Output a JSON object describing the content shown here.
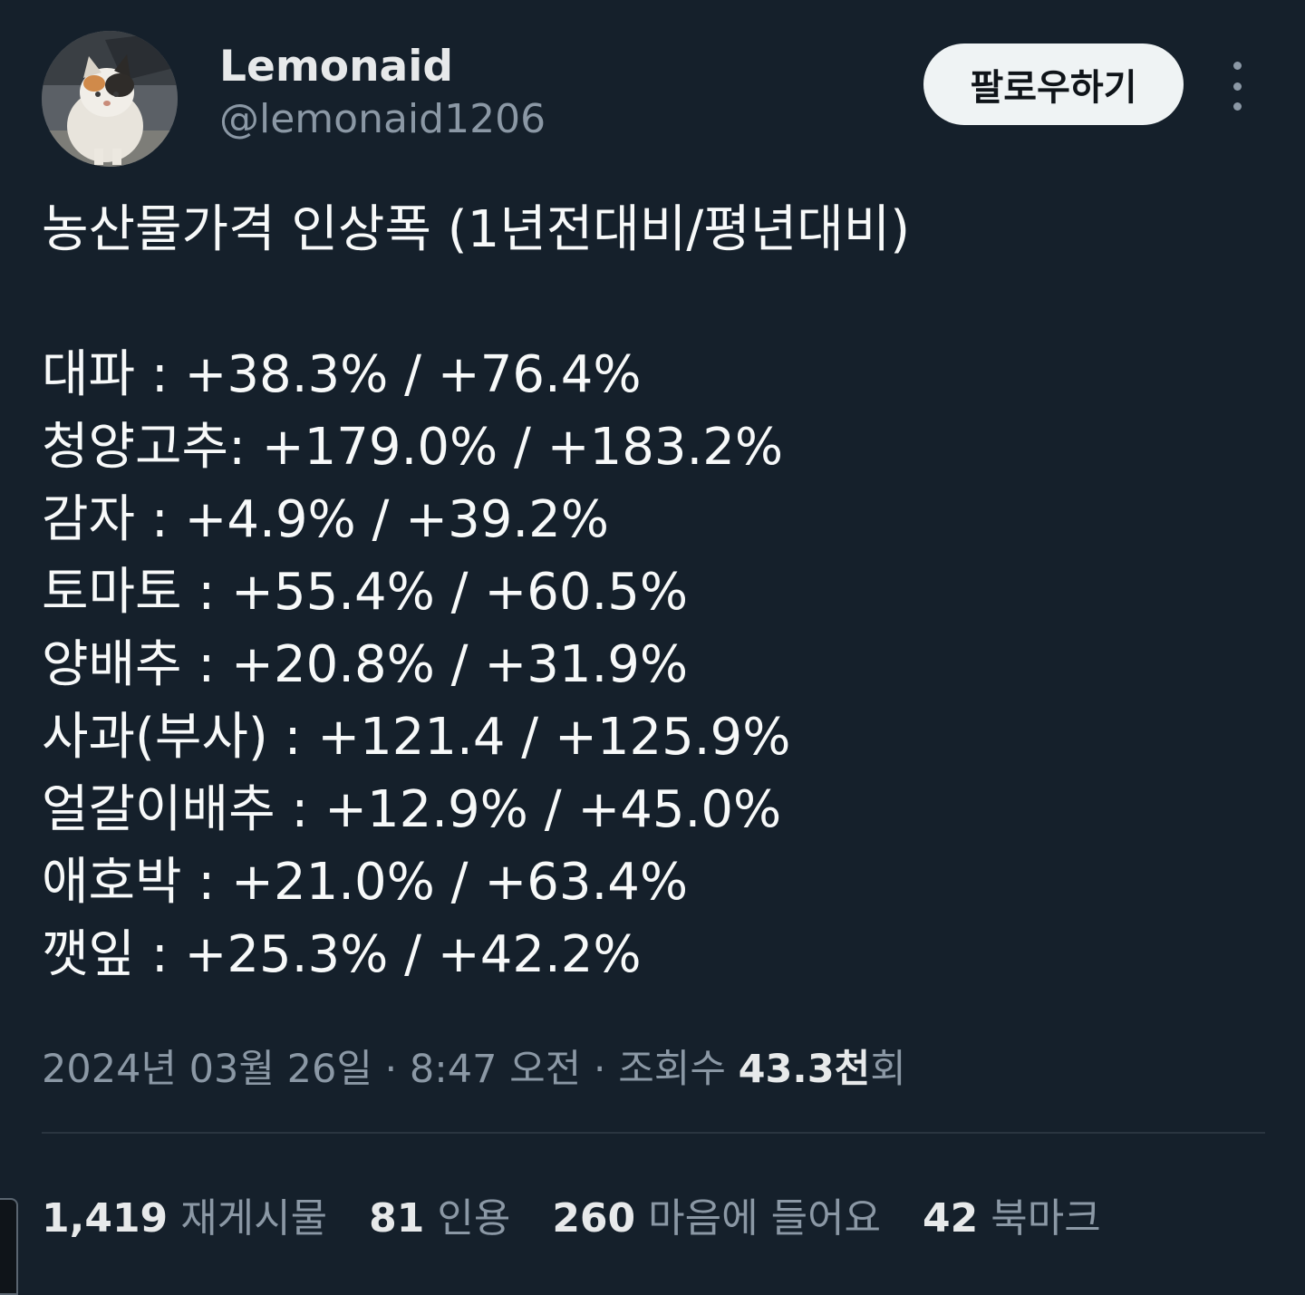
{
  "author": {
    "display_name": "Lemonaid",
    "handle": "@lemonaid1206"
  },
  "follow_label": "팔로우하기",
  "tweet": {
    "title": "농산물가격 인상폭 (1년전대비/평년대비)",
    "lines": [
      "대파 : +38.3% / +76.4%",
      "청양고추: +179.0% / +183.2%",
      "감자 : +4.9% / +39.2%",
      "토마토 : +55.4% / +60.5%",
      "양배추 : +20.8% / +31.9%",
      "사과(부사) : +121.4 / +125.9%",
      "얼갈이배추 : +12.9% / +45.0%",
      "애호박 : +21.0% / +63.4%",
      "깻잎 : +25.3% / +42.2%"
    ]
  },
  "meta": {
    "timestamp": "2024년 03월 26일 · 8:47 오전 · 조회수 ",
    "views_value": "43.3천",
    "views_suffix": "회"
  },
  "stats": [
    {
      "value": "1,419",
      "label": "재게시물"
    },
    {
      "value": "81",
      "label": "인용"
    },
    {
      "value": "260",
      "label": "마음에 들어요"
    },
    {
      "value": "42",
      "label": "북마크"
    }
  ]
}
